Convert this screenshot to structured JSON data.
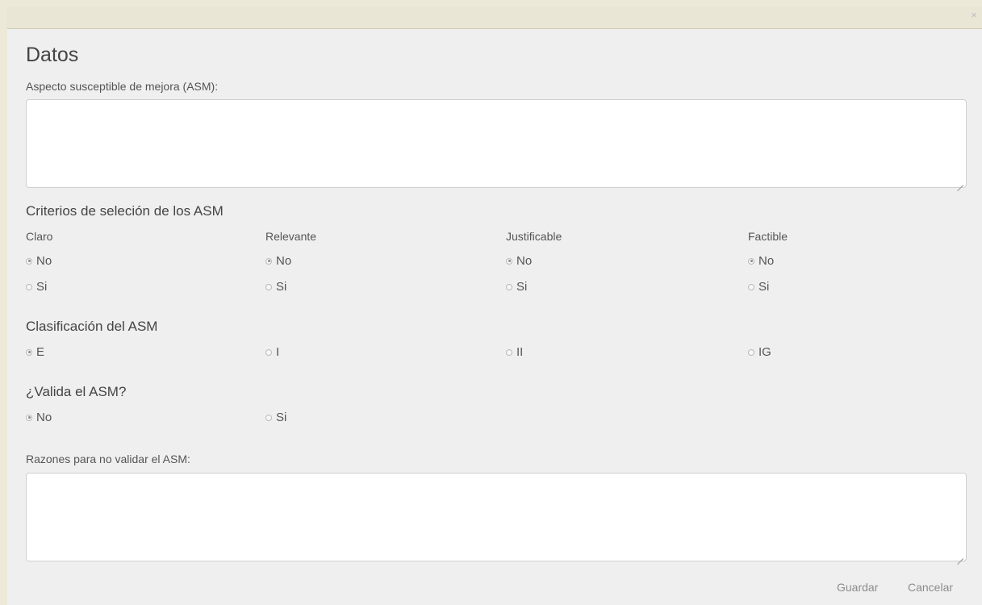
{
  "close_glyph": "×",
  "title": "Datos",
  "asm_label": "Aspecto susceptible de mejora (ASM):",
  "criterios_title": "Criterios de seleción de los ASM",
  "criterios": [
    {
      "name": "Claro",
      "options": [
        "No",
        "Si"
      ],
      "selected": "No"
    },
    {
      "name": "Relevante",
      "options": [
        "No",
        "Si"
      ],
      "selected": "No"
    },
    {
      "name": "Justificable",
      "options": [
        "No",
        "Si"
      ],
      "selected": "No"
    },
    {
      "name": "Factible",
      "options": [
        "No",
        "Si"
      ],
      "selected": "No"
    }
  ],
  "clasificacion_title": "Clasificación del ASM",
  "clasificacion": {
    "options": [
      "E",
      "I",
      "II",
      "IG"
    ],
    "selected": "E"
  },
  "valida_title": "¿Valida el ASM?",
  "valida": {
    "options": [
      "No",
      "Si"
    ],
    "selected": "No"
  },
  "razones_label": "Razones para no validar el ASM:",
  "buttons": {
    "save": "Guardar",
    "cancel": "Cancelar"
  }
}
